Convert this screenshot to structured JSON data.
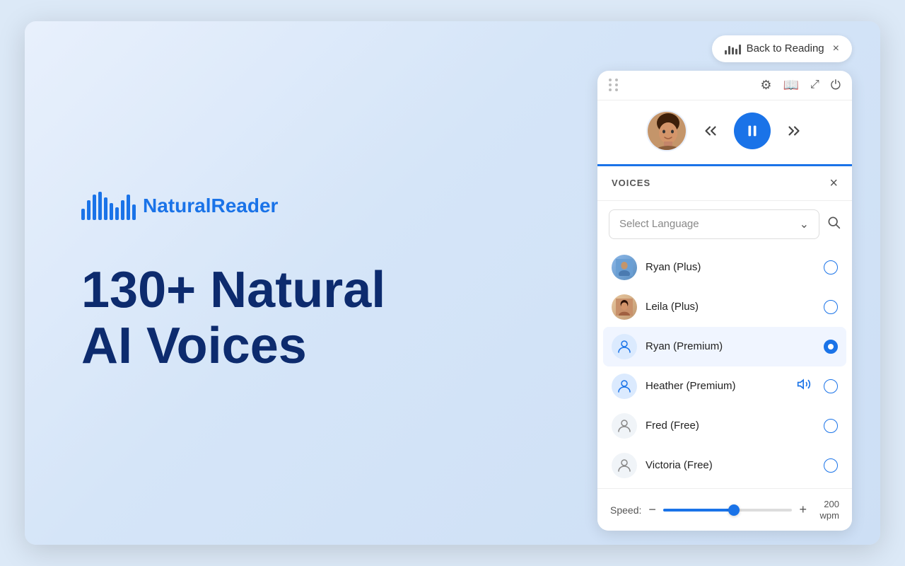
{
  "window": {
    "bg": "#dce9f7"
  },
  "backToReading": {
    "label": "Back to Reading",
    "closeLabel": "×"
  },
  "player": {
    "topbarIcons": [
      "settings",
      "bookmark",
      "expand",
      "power"
    ],
    "controls": {
      "rewindLabel": "↺",
      "pauseLabel": "⏸",
      "forwardLabel": "↻"
    }
  },
  "voices": {
    "panelTitle": "VOICES",
    "closeLabel": "×",
    "languageSelect": {
      "placeholder": "Select Language",
      "chevron": "⌄"
    },
    "items": [
      {
        "name": "Ryan (Plus)",
        "type": "photo",
        "selected": false,
        "playing": false
      },
      {
        "name": "Leila (Plus)",
        "type": "photo",
        "selected": false,
        "playing": false
      },
      {
        "name": "Ryan (Premium)",
        "type": "avatar",
        "selected": true,
        "playing": false
      },
      {
        "name": "Heather (Premium)",
        "type": "avatar",
        "selected": false,
        "playing": true
      },
      {
        "name": "Fred (Free)",
        "type": "avatar",
        "selected": false,
        "playing": false
      },
      {
        "name": "Victoria (Free)",
        "type": "avatar",
        "selected": false,
        "playing": false
      }
    ]
  },
  "speed": {
    "label": "Speed:",
    "minus": "−",
    "plus": "+",
    "value": "200",
    "unit": "wpm",
    "percent": 55
  },
  "hero": {
    "logo": "NaturalReader",
    "title": "130+ Natural\nAI Voices"
  }
}
